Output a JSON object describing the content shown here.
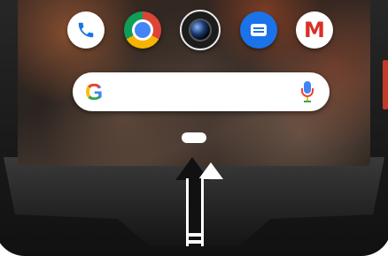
{
  "device": {
    "accent_color": "#c0392b",
    "frame_color": "#1a1a1a"
  },
  "home_screen": {
    "dock_apps": [
      {
        "icon": "phone-icon"
      },
      {
        "icon": "chrome-icon"
      },
      {
        "icon": "camera-icon"
      },
      {
        "icon": "messages-icon"
      },
      {
        "icon": "gmail-icon",
        "glyph": "M"
      }
    ],
    "search_bar": {
      "logo_text": "G",
      "logo_icon": "google-g-icon",
      "mic_icon": "microphone-icon"
    },
    "nav_handle": {
      "icon": "home-gesture-pill"
    }
  },
  "annotation": {
    "icon": "swipe-up-arrow-icon",
    "colors": {
      "outline": "#111111",
      "fill": "#ffffff"
    }
  }
}
